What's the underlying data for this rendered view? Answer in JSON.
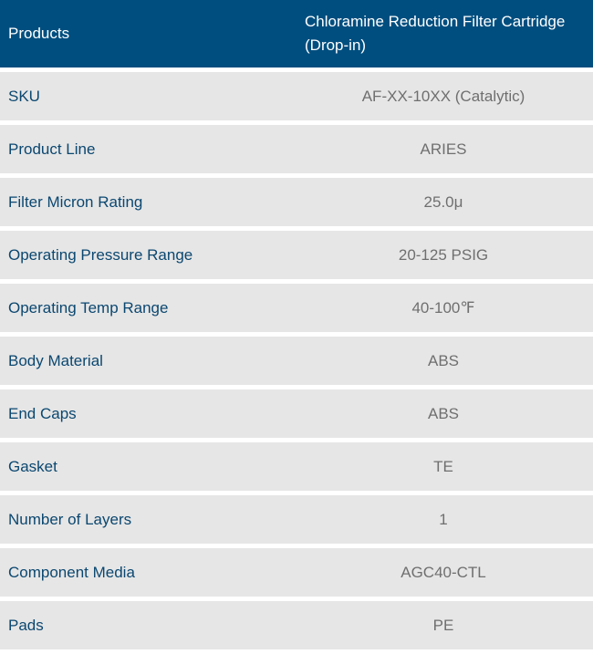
{
  "table": {
    "header": {
      "products_label": "Products",
      "product_name": "Chloramine Reduction Filter Cartridge (Drop-in)"
    },
    "rows": [
      {
        "label": "SKU",
        "value": "AF-XX-10XX (Catalytic)"
      },
      {
        "label": "Product Line",
        "value": "ARIES"
      },
      {
        "label": "Filter Micron Rating",
        "value": "25.0μ"
      },
      {
        "label": "Operating Pressure Range",
        "value": "20-125 PSIG"
      },
      {
        "label": "Operating Temp Range",
        "value": "40-100℉"
      },
      {
        "label": "Body Material",
        "value": "ABS"
      },
      {
        "label": "End Caps",
        "value": "ABS"
      },
      {
        "label": "Gasket",
        "value": "TE"
      },
      {
        "label": "Number of Layers",
        "value": "1"
      },
      {
        "label": "Component Media",
        "value": "AGC40-CTL"
      },
      {
        "label": "Pads",
        "value": "PE"
      }
    ]
  }
}
